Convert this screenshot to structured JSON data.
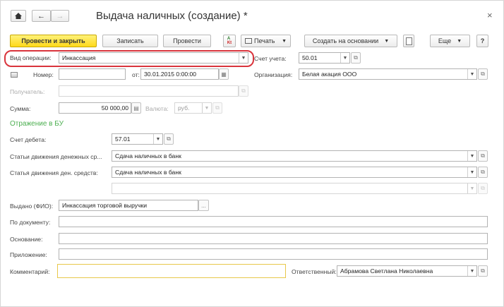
{
  "window": {
    "title": "Выдача наличных (создание) *",
    "close_glyph": "×"
  },
  "nav": {
    "home_icon": "home-icon",
    "back_icon": "arrow-left-icon",
    "forward_icon": "arrow-right-icon"
  },
  "toolbar": {
    "post_close": "Провести и закрыть",
    "save": "Записать",
    "post": "Провести",
    "print": "Печать",
    "create_based": "Создать на основании",
    "more": "Еще",
    "help": "?"
  },
  "form": {
    "operation_type": {
      "label": "Вид операции:",
      "value": "Инкассация"
    },
    "account": {
      "label": "Счет учета:",
      "value": "50.01"
    },
    "number": {
      "label": "Номер:",
      "value": ""
    },
    "date": {
      "label": "от:",
      "value": "30.01.2015  0:00:00"
    },
    "organization": {
      "label": "Организация:",
      "value": "Белая акация ООО"
    },
    "recipient": {
      "label": "Получатель:",
      "value": ""
    },
    "amount": {
      "label": "Сумма:",
      "value": "50 000,00"
    },
    "currency": {
      "label": "Валюта:",
      "value": "руб."
    },
    "section_title": "Отражение в БУ",
    "debit_account": {
      "label": "Счет дебета:",
      "value": "57.01"
    },
    "cash_flow_item1": {
      "label": "Статьи движения денежных ср...",
      "value": "Сдача наличных в банк"
    },
    "cash_flow_item2": {
      "label": "Статья движения ден. средств:",
      "value": "Сдача наличных в банк"
    },
    "extra_field": {
      "value": ""
    },
    "issued_to": {
      "label": "Выдано (ФИО):",
      "value": "Инкассация торговой выручки",
      "button": "..."
    },
    "by_document": {
      "label": "По документу:",
      "value": ""
    },
    "basis": {
      "label": "Основание:",
      "value": ""
    },
    "attachment": {
      "label": "Приложение:",
      "value": ""
    },
    "comment": {
      "label": "Комментарий:",
      "value": ""
    },
    "responsible": {
      "label": "Ответственный:",
      "value": "Абрамова Светлана Николаевна"
    }
  },
  "colors": {
    "accent_yellow": "#ffd91a",
    "highlight_red": "#d9343c",
    "section_green": "#4caf50"
  }
}
